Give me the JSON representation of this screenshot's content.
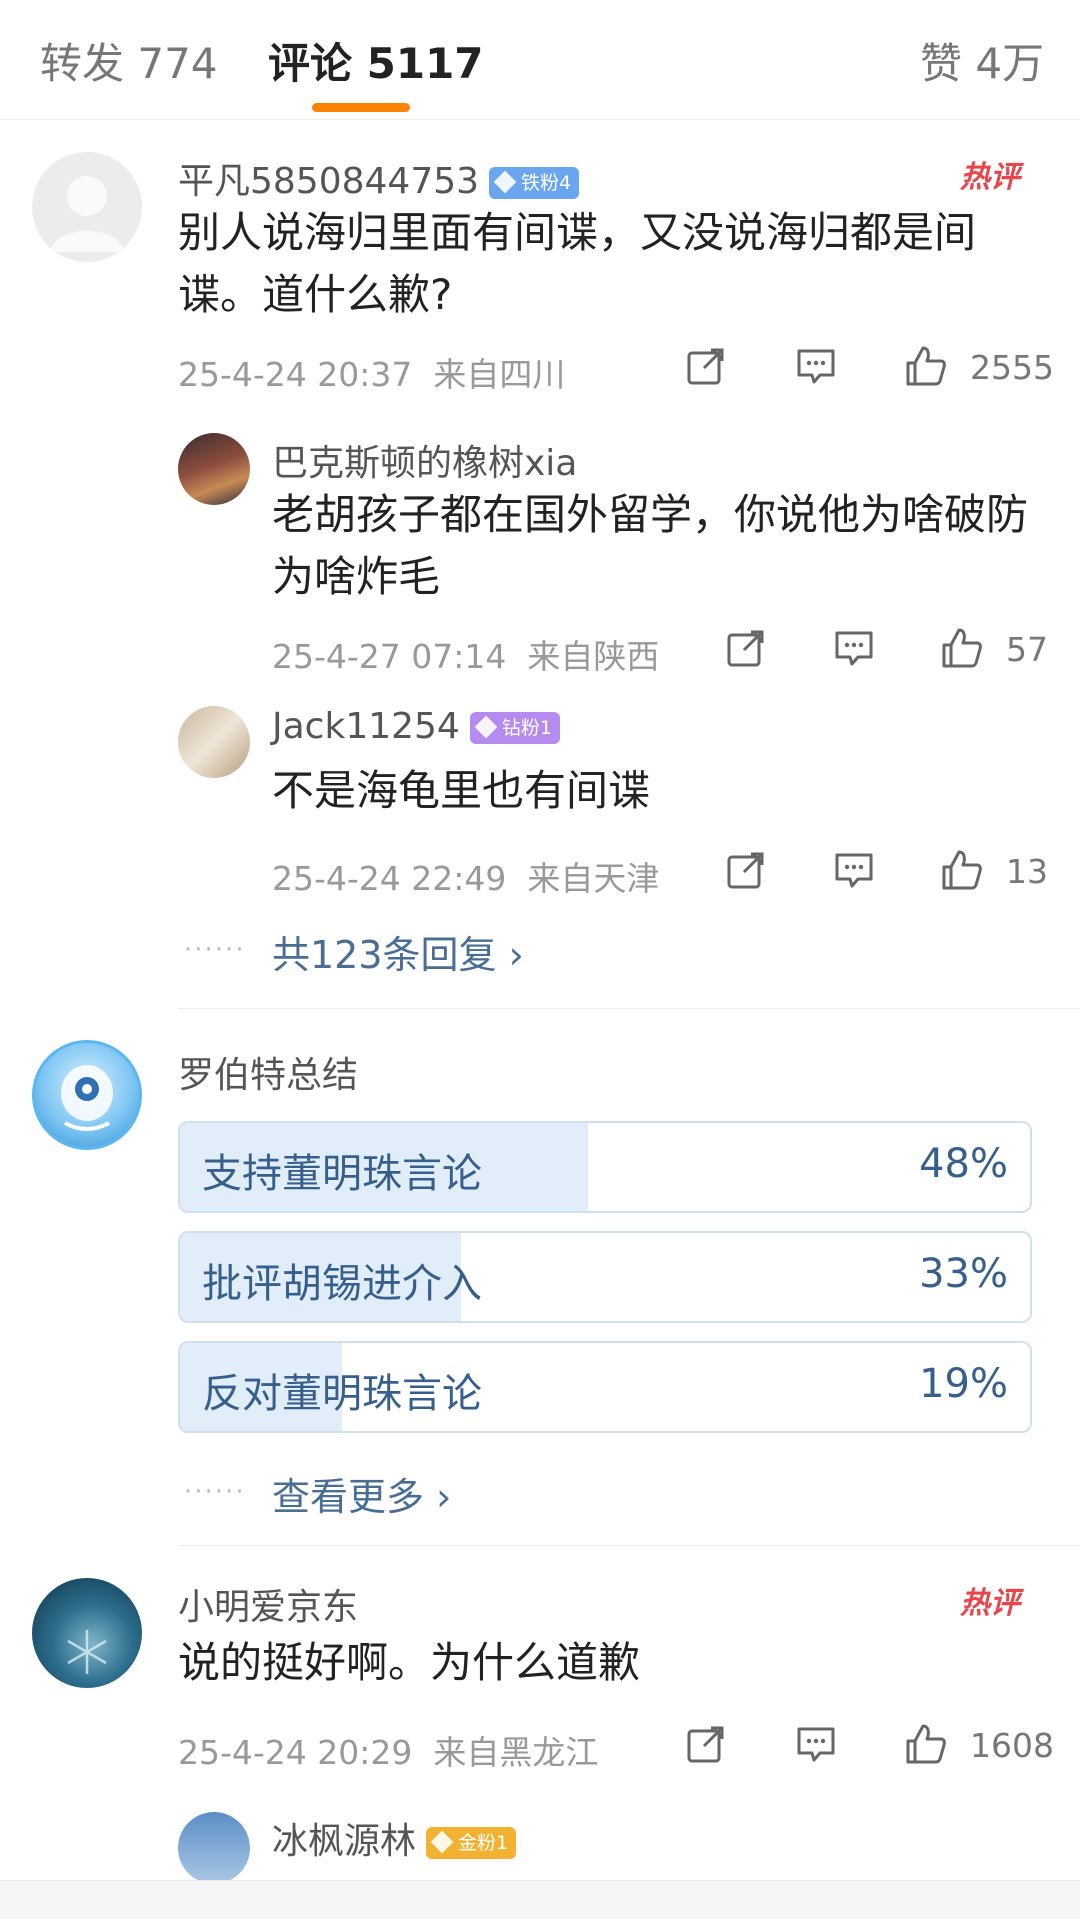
{
  "tabs": {
    "repost": "转发 774",
    "comments": "评论 5117",
    "likes": "赞 4万"
  },
  "comment1": {
    "user": "平凡5850844753",
    "badge": "铁粉4",
    "hot": "热评",
    "text": "别人说海归里面有间谍，又没说海归都是间谍。道什么歉?",
    "time": "25-4-24 20:37",
    "location": "来自四川",
    "likes": "2555",
    "replies": [
      {
        "user": "巴克斯顿的橡树xia",
        "text": "老胡孩子都在国外留学，你说他为啥破防为啥炸毛",
        "time": "25-4-27 07:14",
        "location": "来自陕西",
        "likes": "57"
      },
      {
        "user": "Jack11254",
        "badge": "钻粉1",
        "text": "不是海龟里也有间谍",
        "time": "25-4-24 22:49",
        "location": "来自天津",
        "likes": "13"
      }
    ],
    "more_replies": "共123条回复 ›"
  },
  "poll": {
    "user": "罗伯特总结",
    "options": [
      {
        "label": "支持董明珠言论",
        "pct": "48%",
        "value": 0.48
      },
      {
        "label": "批评胡锡进介入",
        "pct": "33%",
        "value": 0.33
      },
      {
        "label": "反对董明珠言论",
        "pct": "19%",
        "value": 0.19
      }
    ],
    "more": "查看更多 ›"
  },
  "comment2": {
    "user": "小明爱京东",
    "hot": "热评",
    "text": "说的挺好啊。为什么道歉",
    "time": "25-4-24 20:29",
    "location": "来自黑龙江",
    "likes": "1608",
    "reply_user": "冰枫源林",
    "reply_badge": "金粉1"
  },
  "colors": {
    "accent": "#ff8200",
    "iron_badge": "#6aa6ee",
    "diamond_badge": "#b58bf0",
    "gold_badge": "#f2b231",
    "link": "#4a6d94",
    "hot": "#e8464d"
  }
}
